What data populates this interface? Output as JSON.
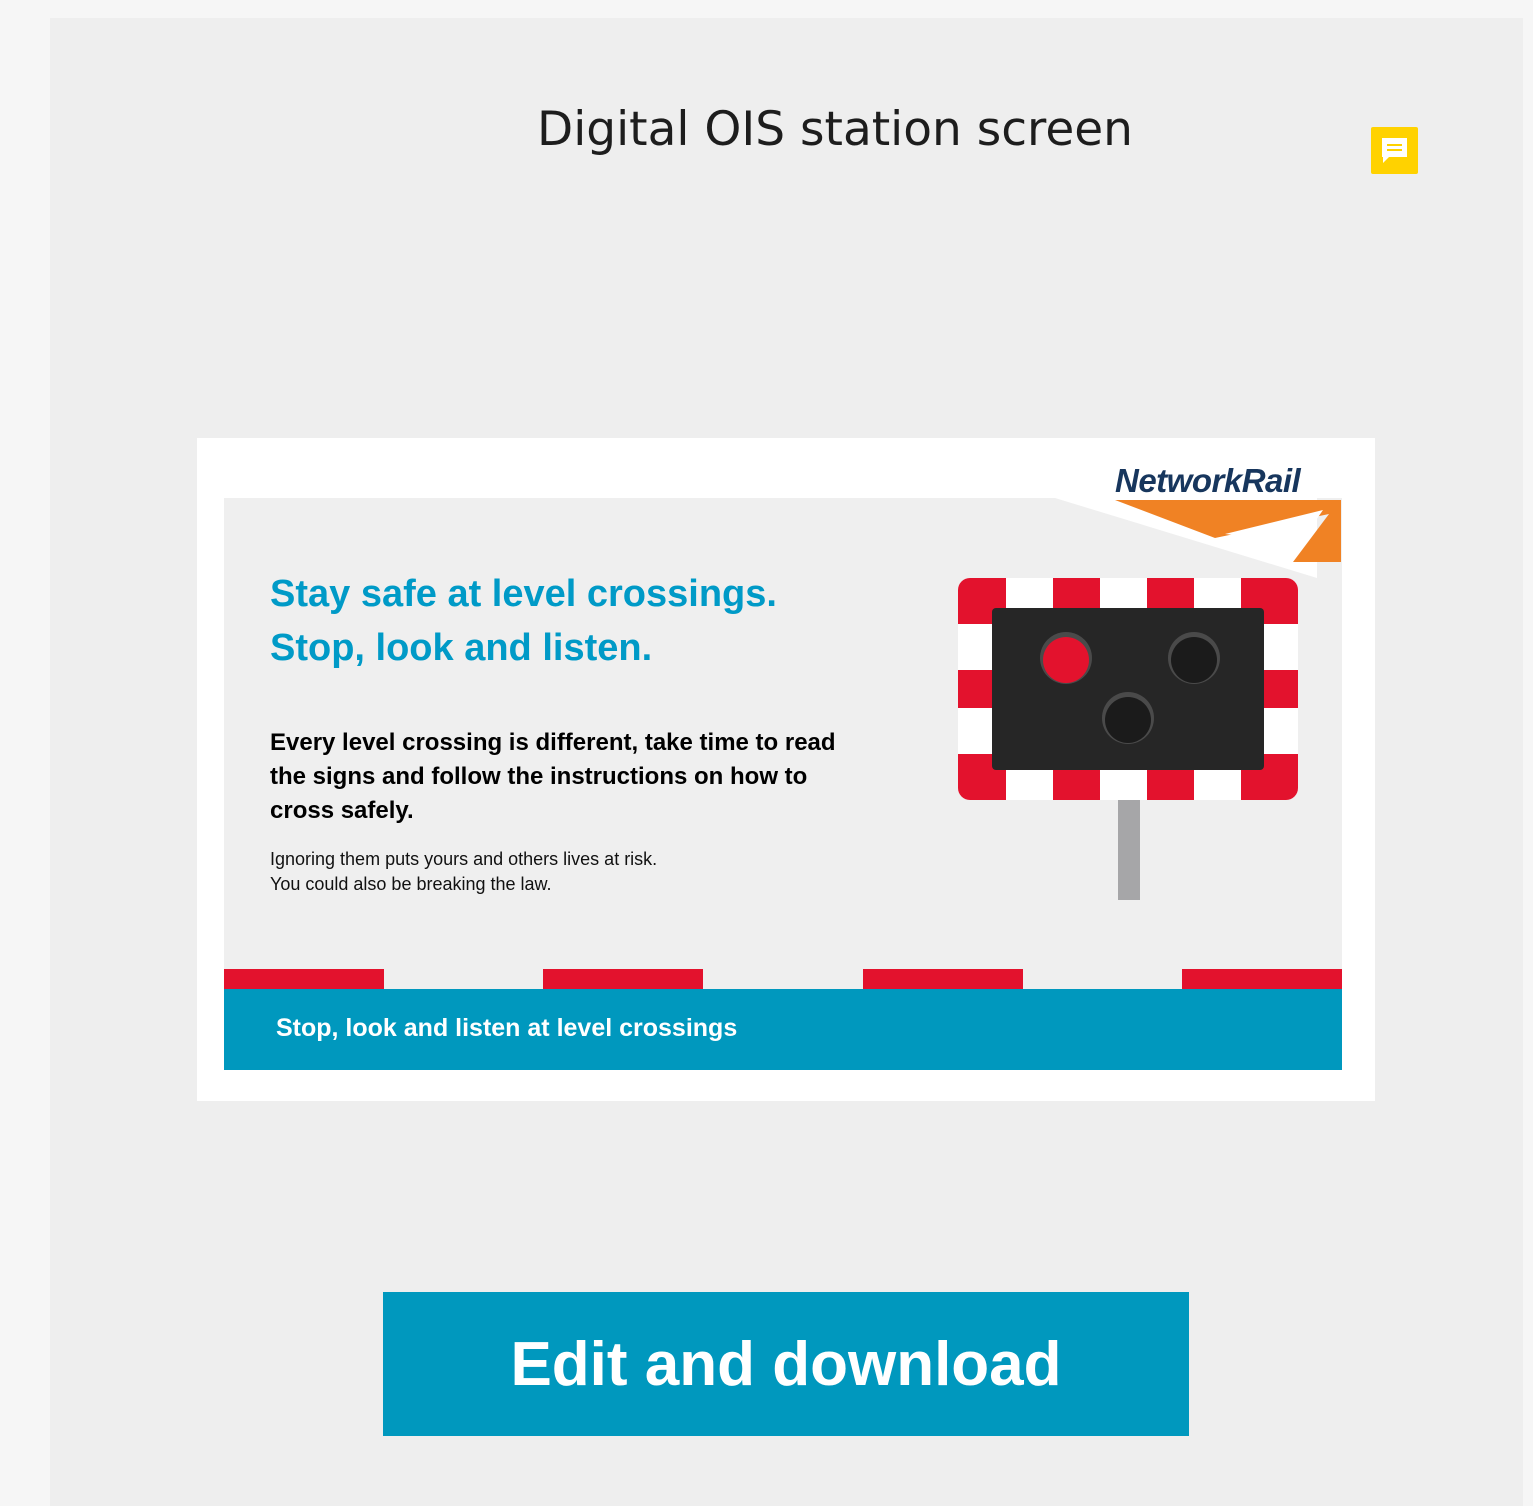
{
  "page": {
    "title": "Digital OIS station screen"
  },
  "comment": {
    "icon": "comment-icon",
    "color": "#ffd200"
  },
  "poster": {
    "logo_text": "NetworkRail",
    "headline_line1": "Stay safe at level crossings.",
    "headline_line2": "Stop, look and listen.",
    "subhead": "Every level crossing is different, take time to read the signs and follow the instructions on how to cross safely.",
    "body_line1": "Ignoring them puts yours and others lives at risk.",
    "body_line2": "You could also be breaking the law.",
    "footer_text": "Stop, look and listen at level crossings",
    "colors": {
      "accent": "#009ac7",
      "stripe_red": "#e3122d",
      "logo_navy": "#17365d",
      "logo_orange": "#f08224",
      "footer_blue": "#0098be"
    }
  },
  "actions": {
    "edit_download_label": "Edit and download",
    "button_color": "#0098be"
  }
}
